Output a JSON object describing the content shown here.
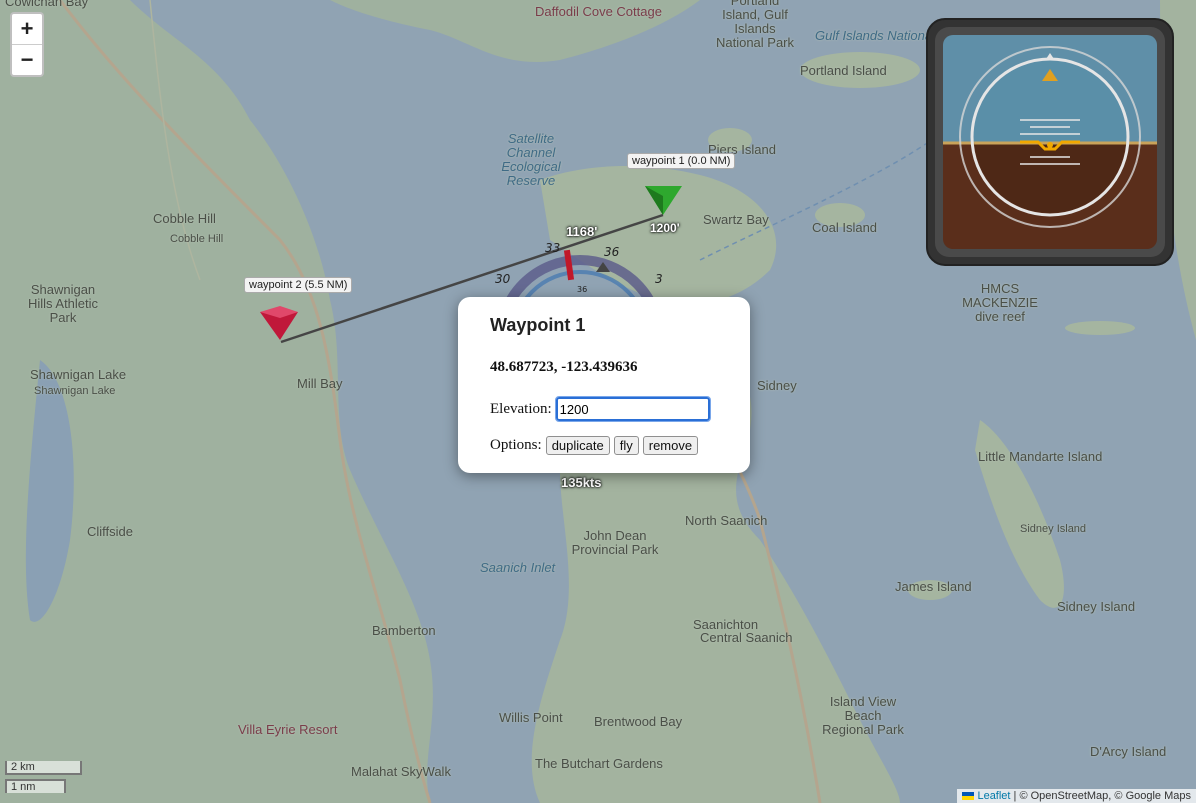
{
  "map": {
    "places": [
      {
        "name": "Cowichan Bay",
        "cls": ""
      },
      {
        "name": "Daffodil Cove Cottage",
        "cls": "poi"
      },
      {
        "name": "Portland Island, Gulf Islands National Park",
        "cls": ""
      },
      {
        "name": "Gulf Islands National",
        "cls": "water"
      },
      {
        "name": "Portland Island",
        "cls": ""
      },
      {
        "name": "Satellite Channel Ecological Reserve",
        "cls": "water"
      },
      {
        "name": "Piers Island",
        "cls": ""
      },
      {
        "name": "Swartz Bay",
        "cls": ""
      },
      {
        "name": "Coal Island",
        "cls": ""
      },
      {
        "name": "Cobble Hill",
        "cls": ""
      },
      {
        "name": "Cobble Hill",
        "cls": "small"
      },
      {
        "name": "Shawnigan Hills Athletic Park",
        "cls": ""
      },
      {
        "name": "Shawnigan Lake",
        "cls": ""
      },
      {
        "name": "Shawnigan Lake",
        "cls": "small"
      },
      {
        "name": "Mill Bay",
        "cls": ""
      },
      {
        "name": "Sidney",
        "cls": ""
      },
      {
        "name": "HMCS MACKENZIE dive reef",
        "cls": ""
      },
      {
        "name": "Little Mandarte Island",
        "cls": ""
      },
      {
        "name": "North Saanich",
        "cls": ""
      },
      {
        "name": "John Dean Provincial Park",
        "cls": ""
      },
      {
        "name": "Sidney Island",
        "cls": "small"
      },
      {
        "name": "James Island",
        "cls": ""
      },
      {
        "name": "Sidney Island",
        "cls": ""
      },
      {
        "name": "Cliffside",
        "cls": ""
      },
      {
        "name": "Saanich Inlet",
        "cls": "water"
      },
      {
        "name": "Saanichton",
        "cls": ""
      },
      {
        "name": "Central Saanich",
        "cls": ""
      },
      {
        "name": "Bamberton",
        "cls": ""
      },
      {
        "name": "Willis Point",
        "cls": ""
      },
      {
        "name": "Brentwood Bay",
        "cls": ""
      },
      {
        "name": "Island View Beach Regional Park",
        "cls": ""
      },
      {
        "name": "Villa Eyrie Resort",
        "cls": "poi"
      },
      {
        "name": "Malahat SkyWalk",
        "cls": ""
      },
      {
        "name": "The Butchart Gardens",
        "cls": ""
      },
      {
        "name": "D'Arcy Island",
        "cls": ""
      }
    ],
    "zoom_in": "+",
    "zoom_out": "−",
    "scale_metric": "2 km",
    "scale_nautical": "1 nm",
    "attribution": {
      "leaflet": "Leaflet",
      "sep1": " | © ",
      "osm": "OpenStreetMap",
      "sep2": ", © ",
      "google": "Google Maps"
    }
  },
  "route": {
    "waypoints": [
      {
        "label": "waypoint 1 (0.0 NM)",
        "alt": "1200'",
        "color": "#2ea82e"
      },
      {
        "label": "waypoint 2 (5.5 NM)",
        "alt": "",
        "color": "#c0183a"
      }
    ],
    "aircraft_alt": "1168'",
    "airspeed": "135kts",
    "heading_ticks": [
      "30",
      "33",
      "36",
      "3"
    ],
    "heading_inner": "36"
  },
  "popup": {
    "title": "Waypoint 1",
    "coords": "48.687723, -123.439636",
    "elevation_label": "Elevation:",
    "elevation_value": "1200",
    "options_label": "Options:",
    "buttons": {
      "duplicate": "duplicate",
      "fly": "fly",
      "remove": "remove"
    }
  },
  "instrument": {
    "sky_color": "#5f8fa8",
    "ground_color": "#5a2e1b",
    "bezel_color": "#3a3a3a"
  }
}
